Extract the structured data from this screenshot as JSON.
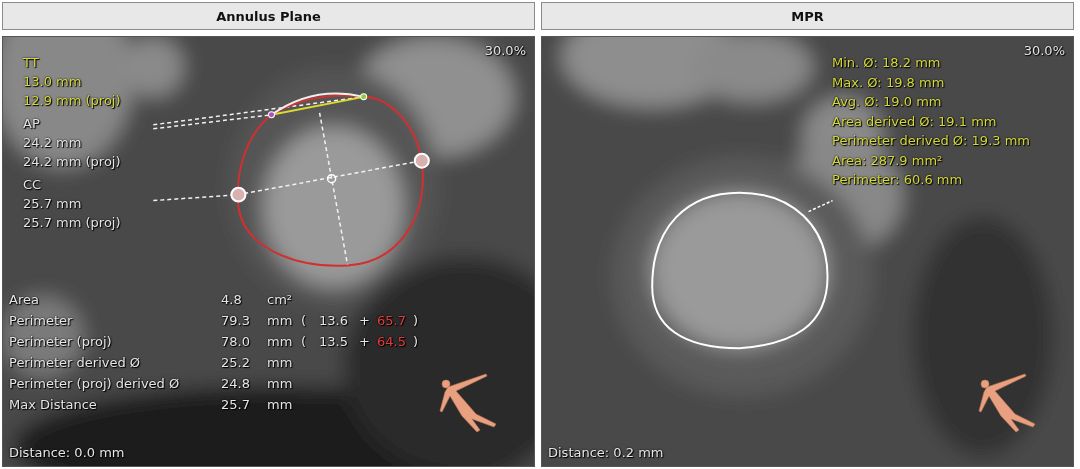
{
  "panels": [
    {
      "kind": "annulus",
      "title": "Annulus Plane",
      "zoom": "30.0%",
      "labels": [
        {
          "name": "TT",
          "values": [
            "13.0 mm",
            "12.9 mm (proj)"
          ],
          "color": "#d4d93a"
        },
        {
          "name": "AP",
          "values": [
            "24.2 mm",
            "24.2 mm (proj)"
          ],
          "color": "#e4e4e4"
        },
        {
          "name": "CC",
          "values": [
            "25.7 mm",
            "25.7 mm (proj)"
          ],
          "color": "#e4e4e4"
        }
      ],
      "table": [
        {
          "label": "Area",
          "value": "4.8",
          "unit": "cm²"
        },
        {
          "label": "Perimeter",
          "value": "79.3",
          "unit": "mm",
          "open": "(",
          "part_1": "13.6",
          "plus": "+",
          "part_2": "65.7",
          "close": ")"
        },
        {
          "label": "Perimeter (proj)",
          "value": "78.0",
          "unit": "mm",
          "open": "(",
          "part_1": "13.5",
          "plus": "+",
          "part_2": "64.5",
          "close": ")"
        },
        {
          "label": "Perimeter derived Ø",
          "value": "25.2",
          "unit": "mm"
        },
        {
          "label": "Perimeter (proj) derived Ø",
          "value": "24.8",
          "unit": "mm"
        },
        {
          "label": "Max Distance",
          "value": "25.7",
          "unit": "mm"
        }
      ],
      "distance": "Distance: 0.0 mm"
    },
    {
      "kind": "mpr",
      "title": "MPR",
      "zoom": "30.0%",
      "measurements": [
        "Min. Ø: 18.2 mm",
        "Max. Ø: 19.8 mm",
        "Avg. Ø: 19.0 mm",
        "Area derived Ø: 19.1 mm",
        "Perimeter derived Ø: 19.3 mm",
        "Area: 287.9 mm²",
        "Perimeter: 60.6 mm"
      ],
      "distance": "Distance: 0.2 mm"
    }
  ]
}
